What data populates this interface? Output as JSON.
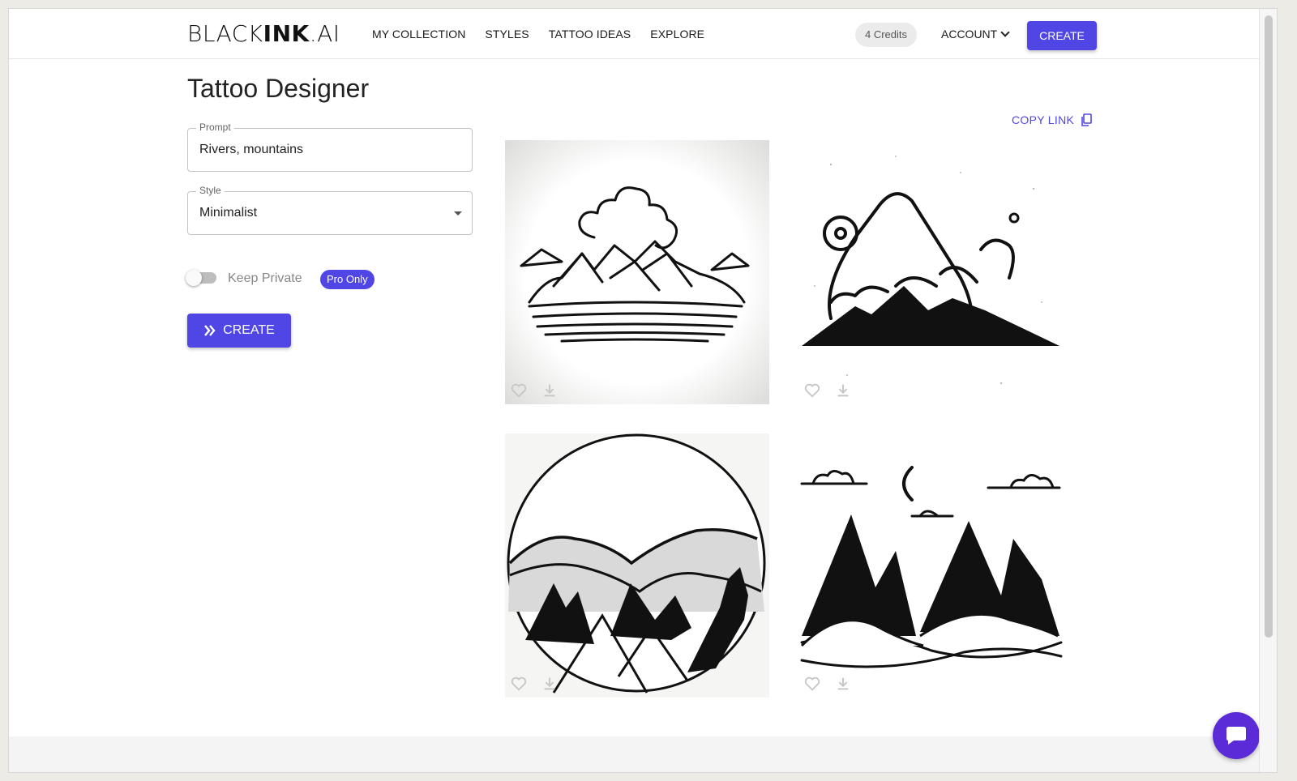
{
  "header": {
    "logo_light": "BLACK",
    "logo_bold": "INK",
    "logo_suffix": ".AI",
    "nav": [
      "MY COLLECTION",
      "STYLES",
      "TATTOO IDEAS",
      "EXPLORE"
    ],
    "credits": "4 Credits",
    "account": "ACCOUNT",
    "create": "CREATE"
  },
  "designer": {
    "title": "Tattoo Designer",
    "prompt_label": "Prompt",
    "prompt_value": "Rivers, mountains",
    "style_label": "Style",
    "style_value": "Minimalist",
    "keep_private_label": "Keep Private",
    "keep_private_on": false,
    "pro_badge": "Pro Only",
    "create_button": "CREATE"
  },
  "gallery": {
    "copy_link": "COPY LINK",
    "tiles": [
      {
        "favorited": false
      },
      {
        "favorited": false
      },
      {
        "favorited": false
      },
      {
        "favorited": false
      }
    ]
  },
  "colors": {
    "accent": "#5046e5",
    "chat": "#5a2bd6"
  },
  "icons": [
    "chevron-down-icon",
    "copy-icon",
    "double-chevron-right-icon",
    "heart-icon",
    "download-icon",
    "chat-icon"
  ]
}
